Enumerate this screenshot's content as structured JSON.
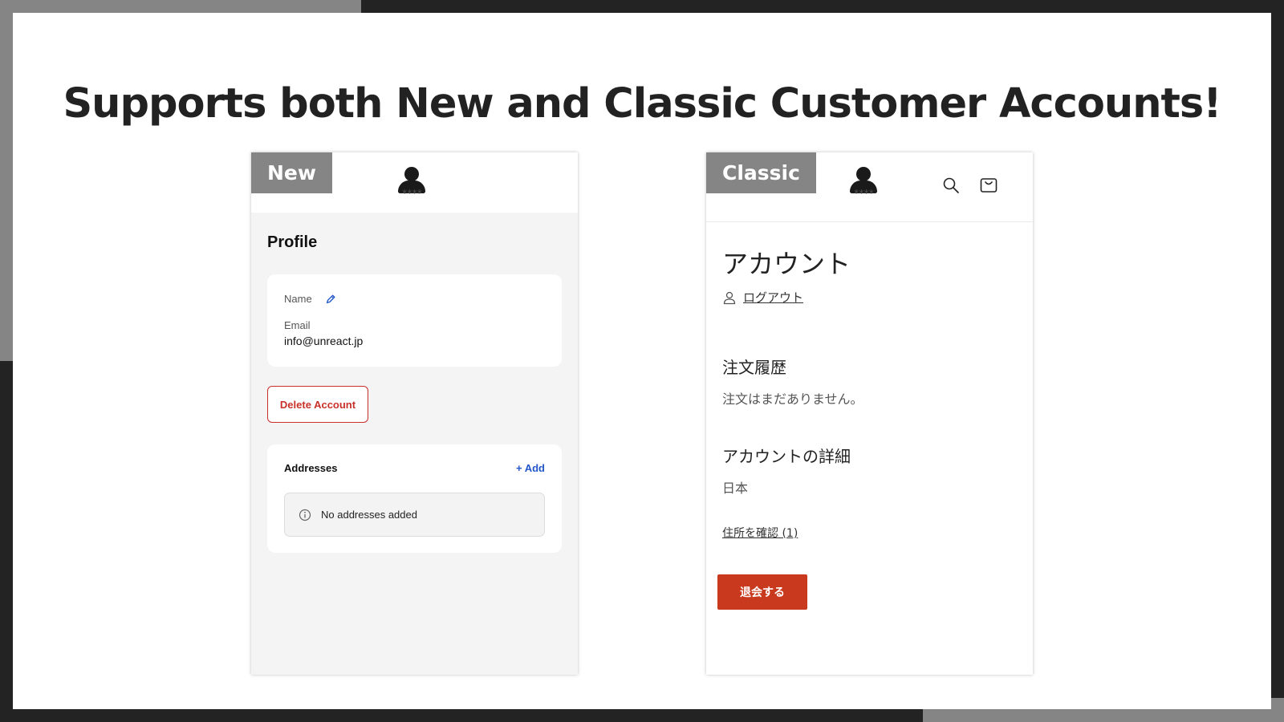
{
  "headline": "Supports both New and Classic Customer Accounts!",
  "logo_text": "****",
  "new_panel": {
    "tag": "New",
    "profile_title": "Profile",
    "name_label": "Name",
    "email_label": "Email",
    "email_value": "info@unreact.jp",
    "delete_label": "Delete Account",
    "addresses_title": "Addresses",
    "add_label": "+ Add",
    "no_addresses": "No addresses added",
    "icons": [
      "pencil-icon",
      "info-icon"
    ],
    "colors": {
      "danger": "#c8302a",
      "link": "#2357c9",
      "background": "#f4f4f4"
    }
  },
  "classic_panel": {
    "tag": "Classic",
    "account_title": "アカウント",
    "logout_label": "ログアウト",
    "order_history_title": "注文履歴",
    "order_history_empty": "注文はまだありません。",
    "account_details_title": "アカウントの詳細",
    "country": "日本",
    "view_addresses": "住所を確認 (1)",
    "withdraw_label": "退会する",
    "icons": [
      "search-icon",
      "cart-icon",
      "user-icon"
    ],
    "colors": {
      "button": "#c8391e"
    }
  }
}
